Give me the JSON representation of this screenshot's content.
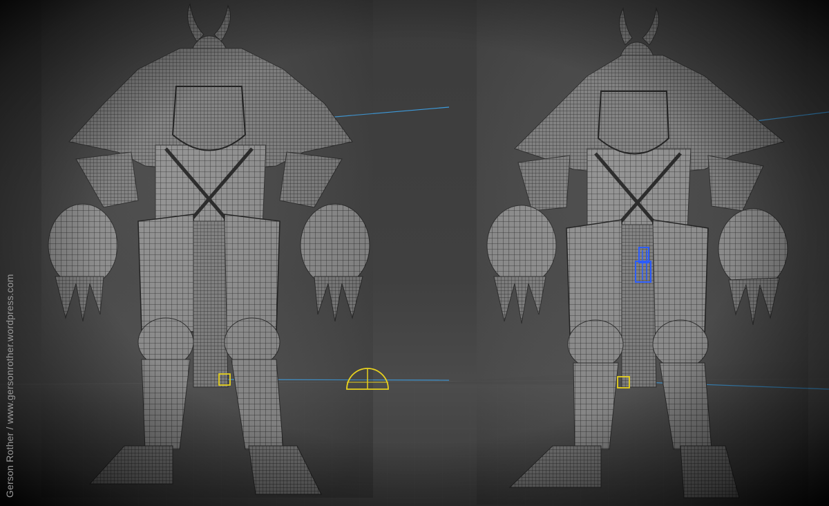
{
  "watermark": {
    "text": "Gerson Rother / www.gersonrother.wordpress.com"
  },
  "scene": {
    "models": [
      {
        "name": "armored-knight-front",
        "pose": "front"
      },
      {
        "name": "armored-knight-front-selected",
        "pose": "front"
      }
    ],
    "colors": {
      "background": "#3c3c3c",
      "mesh_fill": "#8a8a8a",
      "wire": "#1a1a1a",
      "light_line": "#3d9bdc",
      "gizmo": "#e8d21e",
      "selection": "#2b5cff"
    }
  }
}
